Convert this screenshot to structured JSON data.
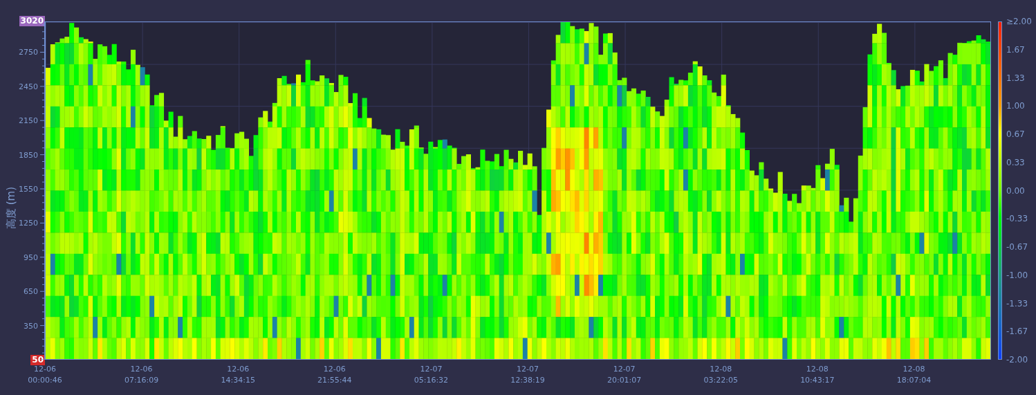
{
  "chart": {
    "y_axis": {
      "label": "高度 (m)",
      "max": "3020",
      "min": "50",
      "ticks": [
        "2750",
        "2450",
        "2150",
        "1850",
        "1550",
        "1250",
        "950",
        "650",
        "350"
      ]
    },
    "x_axis": {
      "ticks": [
        {
          "date": "12-06",
          "time": "00:00:46"
        },
        {
          "date": "12-06",
          "time": "07:16:09"
        },
        {
          "date": "12-06",
          "time": "14:34:15"
        },
        {
          "date": "12-06",
          "time": "21:55:44"
        },
        {
          "date": "12-07",
          "time": "05:16:32"
        },
        {
          "date": "12-07",
          "time": "12:38:19"
        },
        {
          "date": "12-07",
          "time": "20:01:07"
        },
        {
          "date": "12-08",
          "time": "03:22:05"
        },
        {
          "date": "12-08",
          "time": "10:43:17"
        },
        {
          "date": "12-08",
          "time": "18:07:04"
        }
      ]
    },
    "colorbar": {
      "ticks": [
        "≥2.00",
        "1.67",
        "1.33",
        "1.00",
        "0.67",
        "0.33",
        "0.00",
        "-0.33",
        "-0.67",
        "-1.00",
        "-1.33",
        "-1.67",
        "-2.00"
      ]
    }
  }
}
